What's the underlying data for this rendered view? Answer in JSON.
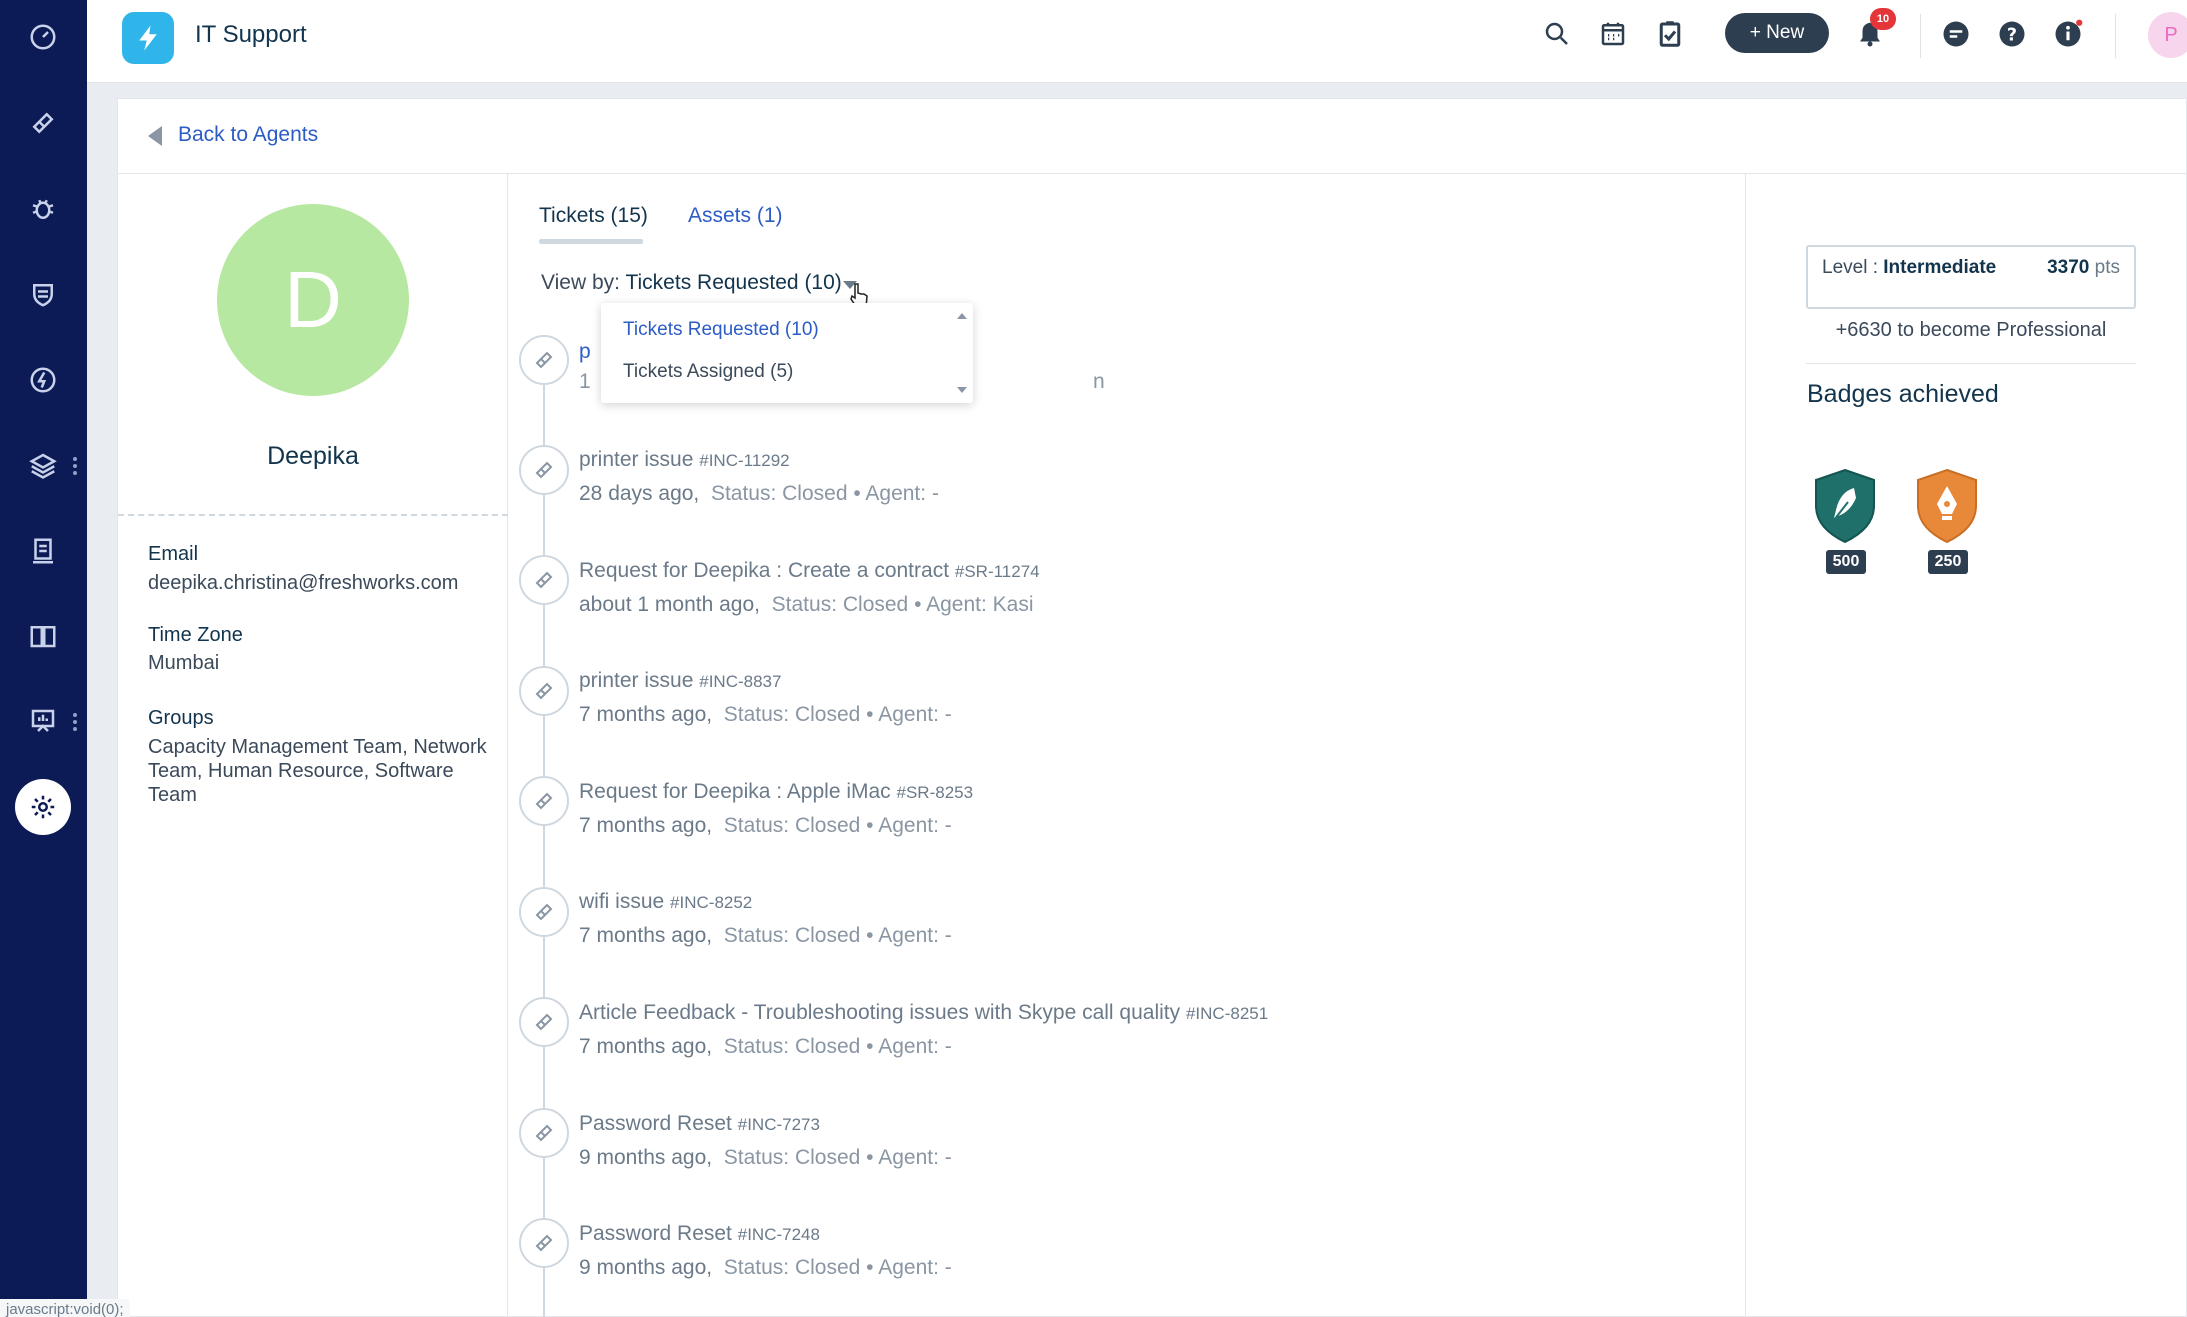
{
  "header": {
    "app_title": "IT Support",
    "new_label": "+ New",
    "notification_count": "10",
    "user_initial": "P"
  },
  "back": {
    "label": "Back to Agents"
  },
  "profile": {
    "initial": "D",
    "name": "Deepika",
    "email_label": "Email",
    "email": "deepika.christina@freshworks.com",
    "timezone_label": "Time Zone",
    "timezone": "Mumbai",
    "groups_label": "Groups",
    "groups": "Capacity Management Team, Network Team, Human Resource, Software Team"
  },
  "tabs": [
    {
      "label": "Tickets (15)"
    },
    {
      "label": "Assets (1)"
    }
  ],
  "viewby": {
    "label": "View by:",
    "value": "Tickets Requested (10)"
  },
  "dropdown": {
    "options": [
      {
        "label": "Tickets Requested (10)",
        "selected": true
      },
      {
        "label": "Tickets Assigned (5)",
        "selected": false
      }
    ]
  },
  "tickets": [
    {
      "title": "p",
      "number": "",
      "ago": "1",
      "status": "",
      "agent": "n"
    },
    {
      "title": "printer issue",
      "number": "#INC-11292",
      "ago": "28 days ago,",
      "status": "Status: Closed",
      "agent": "Agent: -"
    },
    {
      "title": "Request for Deepika : Create a contract",
      "number": "#SR-11274",
      "ago": "about 1 month ago,",
      "status": "Status: Closed",
      "agent": "Agent: Kasi"
    },
    {
      "title": "printer issue",
      "number": "#INC-8837",
      "ago": "7 months ago,",
      "status": "Status: Closed",
      "agent": "Agent: -"
    },
    {
      "title": "Request for Deepika : Apple iMac",
      "number": "#SR-8253",
      "ago": "7 months ago,",
      "status": "Status: Closed",
      "agent": "Agent: -"
    },
    {
      "title": "wifi issue",
      "number": "#INC-8252",
      "ago": "7 months ago,",
      "status": "Status: Closed",
      "agent": "Agent: -"
    },
    {
      "title": "Article Feedback - Troubleshooting issues with Skype call quality",
      "number": "#INC-8251",
      "ago": "7 months ago,",
      "status": "Status: Closed",
      "agent": "Agent: -"
    },
    {
      "title": "Password Reset",
      "number": "#INC-7273",
      "ago": "9 months ago,",
      "status": "Status: Closed",
      "agent": "Agent: -"
    },
    {
      "title": "Password Reset",
      "number": "#INC-7248",
      "ago": "9 months ago,",
      "status": "Status: Closed",
      "agent": "Agent: -"
    }
  ],
  "gamification": {
    "level_label": "Level :",
    "level": "Intermediate",
    "points": "3370",
    "points_unit": "pts",
    "next_level_text": "+6630 to become Professional",
    "badges_title": "Badges achieved",
    "badges": [
      {
        "points": "500",
        "color": "#1f6f6b"
      },
      {
        "points": "250",
        "color": "#e8893a"
      }
    ]
  },
  "statusbar": {
    "text": "javascript:void(0);"
  },
  "colors": {
    "nav_bg": "#0c1a55",
    "link": "#2c5cc5",
    "brand": "#2fb5e9"
  }
}
